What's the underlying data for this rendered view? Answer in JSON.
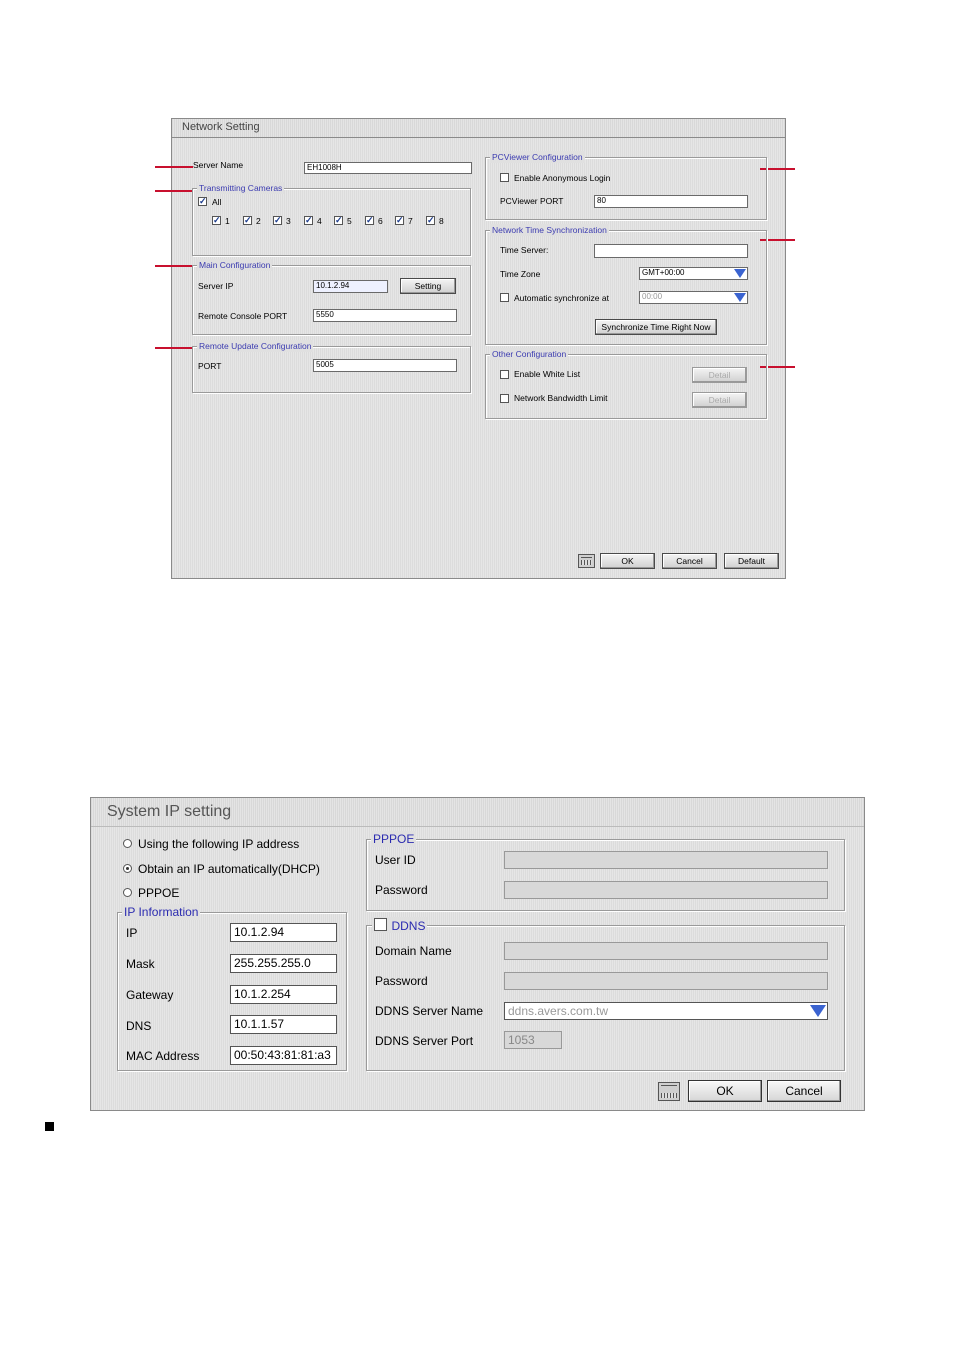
{
  "network": {
    "title": "Network Setting",
    "server_name": {
      "label": "Server Name",
      "value": "EH1008H"
    },
    "transmitting": {
      "legend": "Transmitting Cameras",
      "all_label": "All",
      "all_checked": true,
      "cameras": [
        "1",
        "2",
        "3",
        "4",
        "5",
        "6",
        "7",
        "8"
      ]
    },
    "main_config": {
      "legend": "Main Configuration",
      "server_ip_label": "Server IP",
      "server_ip_value": "10.1.2.94",
      "setting_button": "Setting",
      "remote_port_label": "Remote Console PORT",
      "remote_port_value": "5550"
    },
    "remote_update": {
      "legend": "Remote Update Configuration",
      "port_label": "PORT",
      "port_value": "5005"
    },
    "pcviewer": {
      "legend": "PCViewer Configuration",
      "anonymous_label": "Enable Anonymous Login",
      "anonymous_checked": false,
      "port_label": "PCViewer PORT",
      "port_value": "80"
    },
    "nts": {
      "legend": "Network Time Synchronization",
      "time_server_label": "Time Server:",
      "time_server_value": "",
      "time_zone_label": "Time Zone",
      "time_zone_value": "GMT+00:00",
      "auto_sync_label": "Automatic synchronize at",
      "auto_sync_checked": false,
      "auto_sync_value": "00:00",
      "sync_button": "Synchronize Time Right Now"
    },
    "other": {
      "legend": "Other Configuration",
      "white_list_label": "Enable White List",
      "bandwidth_label": "Network Bandwidth Limit",
      "detail_label": "Detail"
    },
    "buttons": {
      "ok": "OK",
      "cancel": "Cancel",
      "default": "Default"
    }
  },
  "system_ip": {
    "title": "System IP setting",
    "options": [
      "Using the following IP address",
      "Obtain an IP automatically(DHCP)",
      "PPPOE"
    ],
    "selected_option": "Obtain an IP automatically(DHCP)",
    "ip_info": {
      "legend": "IP Information",
      "fields": [
        {
          "label": "IP",
          "value": "10.1.2.94"
        },
        {
          "label": "Mask",
          "value": "255.255.255.0"
        },
        {
          "label": "Gateway",
          "value": "10.1.2.254"
        },
        {
          "label": "DNS",
          "value": "10.1.1.57"
        },
        {
          "label": "MAC Address",
          "value": "00:50:43:81:81:a3"
        }
      ]
    },
    "pppoe": {
      "legend": "PPPOE",
      "user_id_label": "User ID",
      "password_label": "Password"
    },
    "ddns": {
      "legend": "DDNS",
      "checked": false,
      "domain_label": "Domain Name",
      "password_label": "Password",
      "server_name_label": "DDNS Server Name",
      "server_name_value": "ddns.avers.com.tw",
      "server_port_label": "DDNS Server Port",
      "server_port_value": "1053"
    },
    "buttons": {
      "ok": "OK",
      "cancel": "Cancel"
    }
  },
  "colors": {
    "accent_red": "#c8102e",
    "legend_blue": "#3b3bb0",
    "dropdown_arrow": "#3a63d0"
  }
}
